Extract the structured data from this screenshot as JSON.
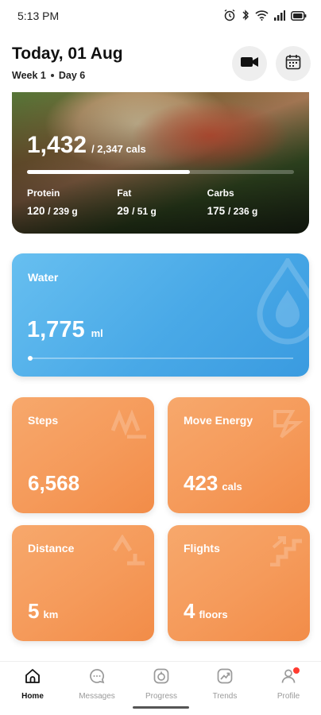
{
  "status": {
    "time": "5:13 PM"
  },
  "header": {
    "title": "Today, 01 Aug",
    "week": "Week 1",
    "day": "Day 6"
  },
  "calories": {
    "consumed": "1,432",
    "total": "/ 2,347 cals",
    "progress": 0.61,
    "macros": [
      {
        "label": "Protein",
        "value": "120",
        "target": "/ 239 g"
      },
      {
        "label": "Fat",
        "value": "29",
        "target": "/ 51 g"
      },
      {
        "label": "Carbs",
        "value": "175",
        "target": "/ 236 g"
      }
    ]
  },
  "water": {
    "label": "Water",
    "value": "1,775",
    "unit": "ml",
    "progress": 0.0
  },
  "tiles": {
    "steps": {
      "label": "Steps",
      "value": "6,568",
      "unit": ""
    },
    "move": {
      "label": "Move Energy",
      "value": "423",
      "unit": "cals"
    },
    "distance": {
      "label": "Distance",
      "value": "5",
      "unit": "km"
    },
    "flights": {
      "label": "Flights",
      "value": "4",
      "unit": "floors"
    }
  },
  "nav": [
    {
      "label": "Home",
      "icon": "home-icon",
      "active": true
    },
    {
      "label": "Messages",
      "icon": "messages-icon",
      "active": false
    },
    {
      "label": "Progress",
      "icon": "progress-icon",
      "active": false
    },
    {
      "label": "Trends",
      "icon": "trends-icon",
      "active": false
    },
    {
      "label": "Profile",
      "icon": "profile-icon",
      "active": false
    }
  ],
  "colors": {
    "water": "#49a9e7",
    "tile": "#f59a5a",
    "badge": "#ff3b30"
  }
}
